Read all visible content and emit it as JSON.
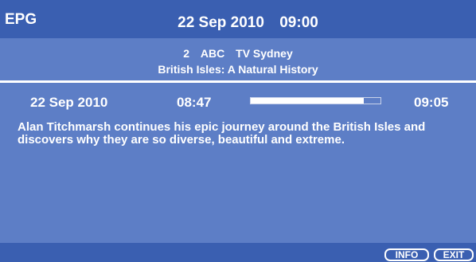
{
  "header": {
    "title": "EPG",
    "date": "22 Sep 2010",
    "time": "09:00"
  },
  "channel": {
    "number": "2",
    "name": "ABC",
    "region": "TV Sydney"
  },
  "programme": {
    "title": "British Isles: A Natural History",
    "date": "22 Sep 2010",
    "start_time": "08:47",
    "end_time": "09:05",
    "progress": 0.87,
    "description": "Alan Titchmarsh continues his epic journey around the British Isles and discovers why they are so diverse, beautiful and extreme."
  },
  "footer": {
    "info_label": "INFO",
    "exit_label": "EXIT"
  },
  "colors": {
    "header_bg": "#3a5fb1",
    "body_bg": "#5d7ec6",
    "text": "#ffffff"
  }
}
